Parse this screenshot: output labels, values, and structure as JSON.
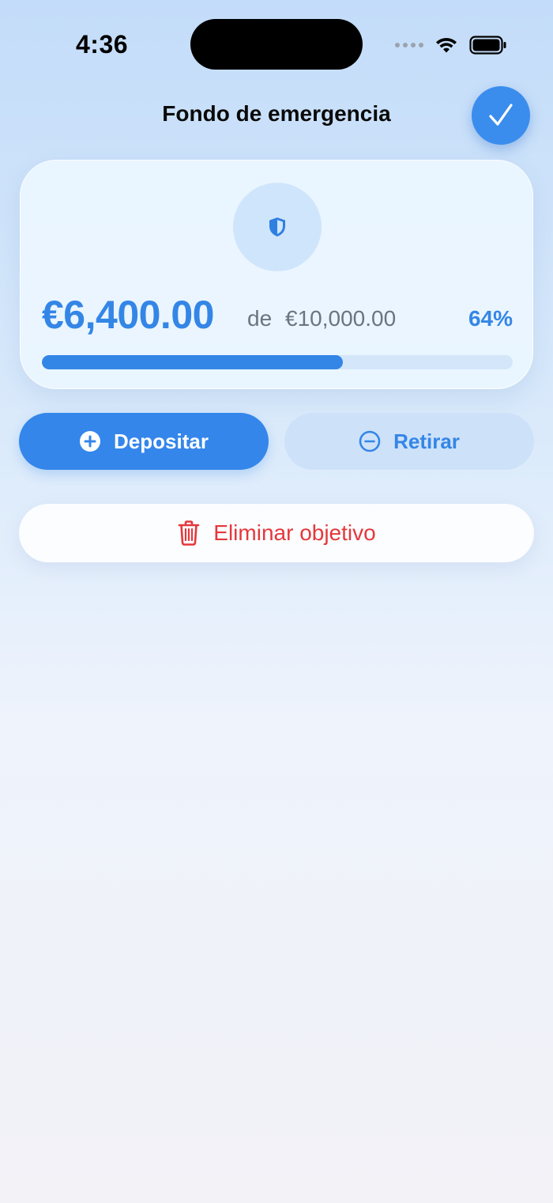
{
  "status_bar": {
    "time": "4:36"
  },
  "header": {
    "title": "Fondo de emergencia",
    "confirm_icon": "checkmark-icon"
  },
  "goal": {
    "icon": "shield-icon",
    "current_amount": "€6,400.00",
    "of_label": "de",
    "target_amount": "€10,000.00",
    "percent_label": "64%",
    "progress_fraction": 0.64
  },
  "actions": {
    "deposit_label": "Depositar",
    "deposit_icon": "plus-circle-icon",
    "withdraw_label": "Retirar",
    "withdraw_icon": "minus-circle-icon",
    "delete_label": "Eliminar objetivo",
    "delete_icon": "trash-icon"
  },
  "colors": {
    "accent": "#3486e6",
    "danger": "#e5383b",
    "track": "#d4e6f9"
  }
}
